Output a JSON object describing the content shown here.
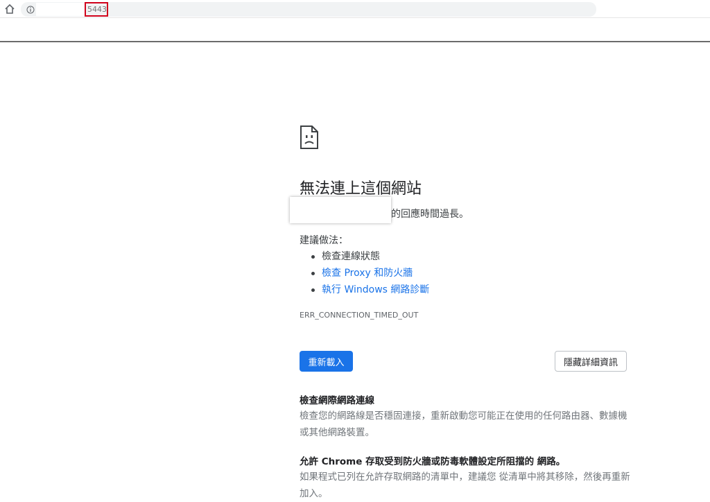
{
  "toolbar": {
    "home_icon": "home-icon",
    "info_icon": "info-icon",
    "url_port": "5443"
  },
  "error": {
    "icon": "sad-page-icon",
    "title": "無法連上這個網站",
    "timeout_message": "的回應時間過長。",
    "suggestions_label": "建議做法：",
    "suggestions": [
      "檢查連線狀態",
      "檢查 Proxy 和防火牆",
      "執行 Windows 網路診斷"
    ],
    "code": "ERR_CONNECTION_TIMED_OUT"
  },
  "buttons": {
    "reload": "重新載入",
    "hide_details": "隱藏詳細資訊"
  },
  "details": {
    "section1_title": "檢查網際網路連線",
    "section1_text": "檢查您的網路線是否穩固連接，重新啟動您可能正在使用的任何路由器、數據機或其他網路裝置。",
    "section2_title": "允許 Chrome 存取受到防火牆或防毒軟體設定所阻擋的 網路。",
    "section2_text": "如果程式已列在允許存取網路的清單中，建議您 從清單中將其移除，然後再重新加入。"
  },
  "colors": {
    "link": "#1a73e8",
    "primary_button": "#1a73e8",
    "highlight_border": "#d0021b"
  }
}
